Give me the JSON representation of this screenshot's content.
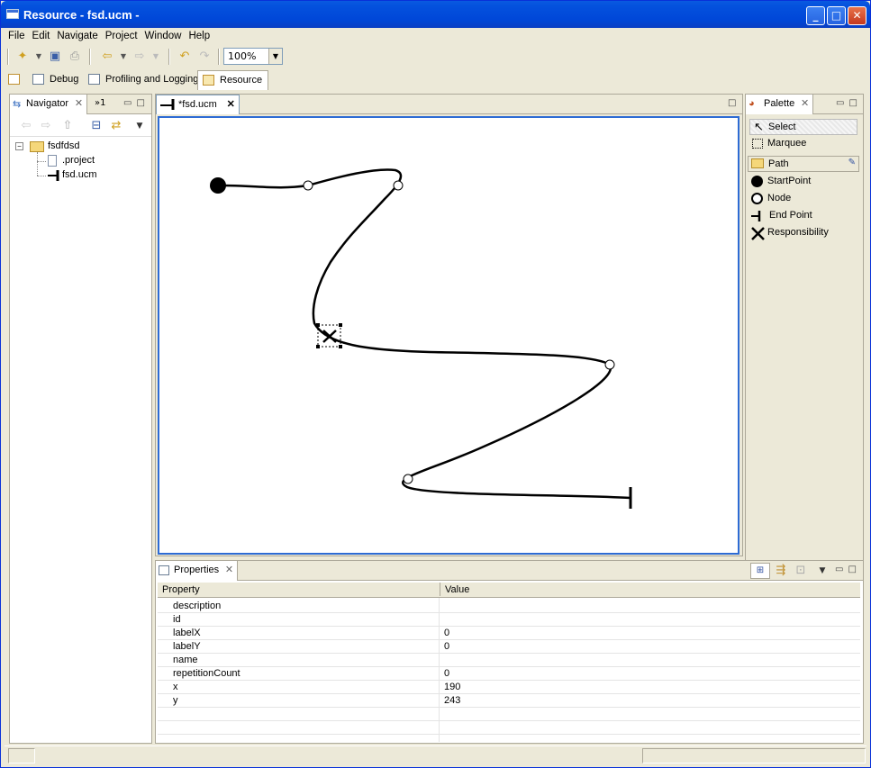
{
  "window": {
    "title": "Resource - fsd.ucm -"
  },
  "menu": [
    "File",
    "Edit",
    "Navigate",
    "Project",
    "Window",
    "Help"
  ],
  "toolbar": {
    "zoom": "100%"
  },
  "perspectives": [
    "Debug",
    "Profiling and Logging",
    "Resource"
  ],
  "navigator": {
    "tab_label": "Navigator",
    "overflow_label": "»1",
    "tree": [
      {
        "label": "fsdfdsd",
        "type": "project"
      },
      {
        "label": ".project",
        "type": "file"
      },
      {
        "label": "fsd.ucm",
        "type": "ucm"
      }
    ]
  },
  "editor": {
    "tab_label": "*fsd.ucm"
  },
  "palette": {
    "tab_label": "Palette",
    "tools": [
      "Select",
      "Marquee"
    ],
    "drawer": "Path",
    "items": [
      "StartPoint",
      "Node",
      "End Point",
      "Responsibility"
    ]
  },
  "properties": {
    "tab_label": "Properties",
    "columns": [
      "Property",
      "Value"
    ],
    "rows": [
      {
        "key": "description",
        "value": ""
      },
      {
        "key": "id",
        "value": ""
      },
      {
        "key": "labelX",
        "value": "0"
      },
      {
        "key": "labelY",
        "value": "0"
      },
      {
        "key": "name",
        "value": ""
      },
      {
        "key": "repetitionCount",
        "value": "0"
      },
      {
        "key": "x",
        "value": "190"
      },
      {
        "key": "y",
        "value": "243"
      }
    ]
  },
  "colors": {
    "accent": "#2d6bd4",
    "title_bar": "#0047d8",
    "chrome": "#ece9d8"
  }
}
